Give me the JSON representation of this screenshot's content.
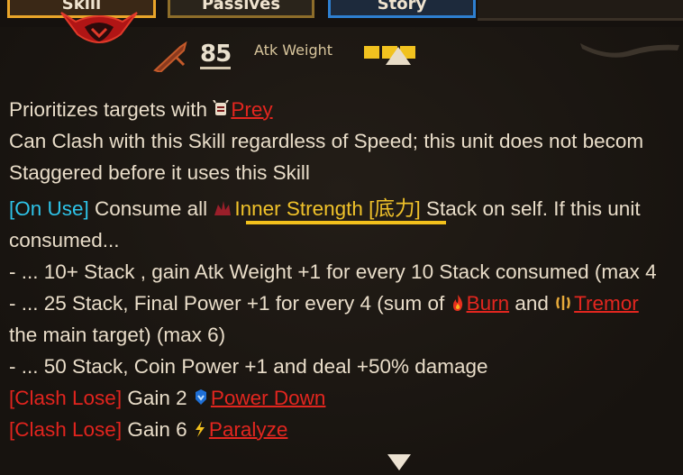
{
  "tabs": [
    {
      "label": "Skill",
      "state": "active"
    },
    {
      "label": "Passives",
      "state": "inactive"
    },
    {
      "label": "Story",
      "state": "inactive"
    }
  ],
  "header": {
    "offense_level": "85",
    "atk_weight_label": "Atk Weight",
    "atk_weight_value": 3,
    "skill_icon": "red-demon-mask-icon",
    "weapon_icon": "blade-icon"
  },
  "lines": {
    "l1_text": "Prioritizes targets with ",
    "l1_kw": "Prey",
    "l2_text": "Can Clash with this Skill regardless of Speed; this unit does not becom",
    "l3_text": "Staggered before it uses this Skill",
    "l4_tag": "[On Use]",
    "l4_text_a": " Consume all ",
    "l4_kw": "Inner Strength [底力]",
    "l4_text_b": " Stack on self. If this unit",
    "l5_text": "consumed...",
    "l6_text": "- ... 10+ Stack , gain Atk Weight +1 for every 10 Stack consumed (max 4",
    "l7_text_a": "- ... 25 Stack, Final Power +1 for every 4 (sum of ",
    "l7_kw1": "Burn",
    "l7_text_b": " and ",
    "l7_kw2": "Tremor",
    "l8_text": "the main target) (max 6)",
    "l9_text": "- ... 50 Stack, Coin Power +1 and deal +50% damage",
    "l10_tag": "[Clash Lose]",
    "l10_text": " Gain 2 ",
    "l10_kw": "Power Down",
    "l11_tag": "[Clash Lose]",
    "l11_text": " Gain 6 ",
    "l11_kw": "Paralyze"
  },
  "colors": {
    "background": "#1b1713",
    "body_text": "#e9ddc9",
    "tag_cyan": "#2ec3e8",
    "keyword_red": "#e0241e",
    "keyword_gold": "#f0c22a",
    "tab_border_active": "#e9a52a",
    "tab_border_blue": "#2e7fd0"
  }
}
